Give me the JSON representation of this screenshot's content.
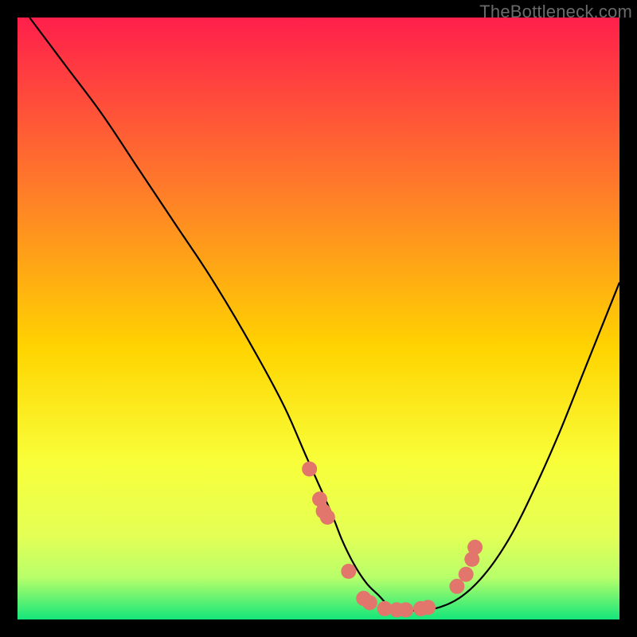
{
  "attribution": "TheBottleneck.com",
  "colors": {
    "top": "#ff1f4b",
    "mid1": "#ff7a2a",
    "mid2": "#ffd400",
    "mid3": "#f8ff3a",
    "low1": "#e4ff55",
    "low2": "#b8ff6a",
    "bottom": "#14e67a",
    "curve": "#000000",
    "marker": "#e2766c",
    "frame": "#000000"
  },
  "chart_data": {
    "type": "line",
    "title": "",
    "xlabel": "",
    "ylabel": "",
    "xlim": [
      0,
      100
    ],
    "ylim": [
      0,
      100
    ],
    "series": [
      {
        "name": "curve",
        "x": [
          2,
          8,
          14,
          20,
          26,
          32,
          38,
          44,
          48,
          52,
          54,
          56,
          58,
          60,
          62,
          64,
          66,
          70,
          74,
          78,
          82,
          86,
          90,
          94,
          98,
          100
        ],
        "y": [
          100,
          92,
          84,
          75,
          66,
          57,
          47,
          36,
          27,
          18,
          13,
          9,
          6,
          4,
          2,
          1.5,
          1.5,
          2,
          4,
          8,
          14,
          22,
          31,
          41,
          51,
          56
        ]
      }
    ],
    "markers": {
      "name": "dots",
      "x": [
        48.5,
        50.2,
        50.8,
        51.5,
        55.0,
        57.5,
        58.5,
        61.0,
        63.0,
        64.5,
        67.0,
        68.2,
        73.0,
        74.5,
        75.5,
        76.0
      ],
      "y": [
        25.0,
        20.0,
        18.0,
        17.0,
        8.0,
        3.5,
        2.8,
        1.8,
        1.6,
        1.6,
        1.8,
        2.0,
        5.5,
        7.5,
        10.0,
        12.0
      ]
    },
    "gradient_stops": [
      {
        "offset": 0.0,
        "key": "top"
      },
      {
        "offset": 0.28,
        "key": "mid1"
      },
      {
        "offset": 0.55,
        "key": "mid2"
      },
      {
        "offset": 0.74,
        "key": "mid3"
      },
      {
        "offset": 0.86,
        "key": "low1"
      },
      {
        "offset": 0.93,
        "key": "low2"
      },
      {
        "offset": 1.0,
        "key": "bottom"
      }
    ]
  }
}
